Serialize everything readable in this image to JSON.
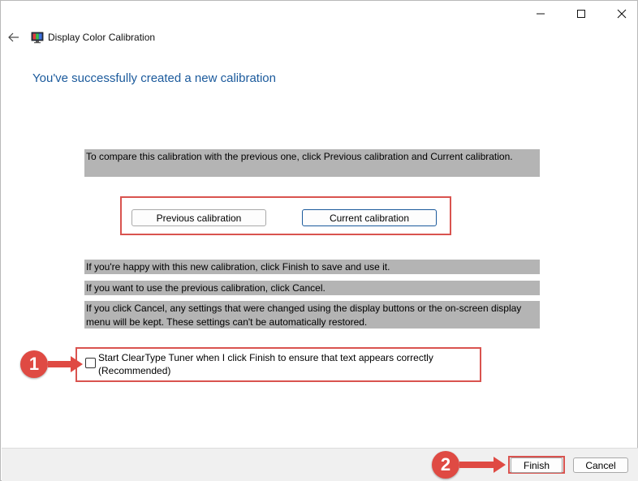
{
  "window": {
    "title": "Display Color Calibration"
  },
  "heading": "You've successfully created a new calibration",
  "instructions": {
    "compare": "To compare this calibration with the previous one, click Previous calibration and Current calibration.",
    "happy": "If you're happy with this new calibration, click Finish to save and use it.",
    "previous": "If you want to use the previous calibration, click Cancel.",
    "cancel_note": "If you click Cancel, any settings that were changed using the display buttons or the on-screen display menu will be kept. These settings can't be automatically restored."
  },
  "buttons": {
    "previous_calibration": "Previous calibration",
    "current_calibration": "Current calibration",
    "finish": "Finish",
    "cancel": "Cancel"
  },
  "checkbox": {
    "label": "Start ClearType Tuner when I click Finish to ensure that text appears correctly (Recommended)",
    "checked": false
  },
  "annotations": {
    "step1": "1",
    "step2": "2",
    "highlight_color": "#d9534f"
  },
  "icons": {
    "back": "back-arrow-icon",
    "app": "display-color-calibration-icon",
    "minimize": "minimize-icon",
    "maximize": "maximize-icon",
    "close": "close-icon"
  }
}
